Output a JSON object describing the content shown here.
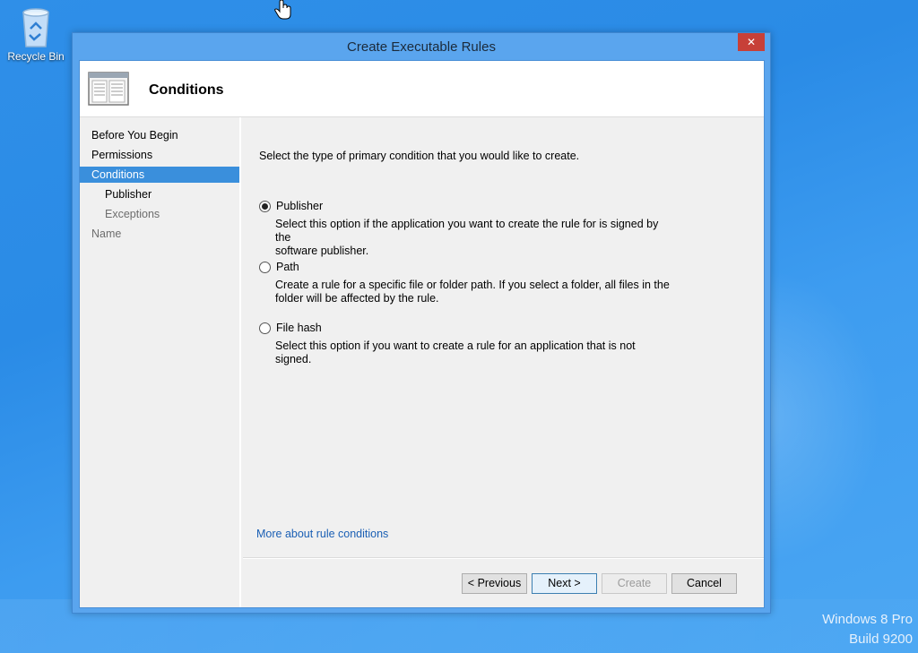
{
  "desktop": {
    "recycle_bin_label": "Recycle Bin",
    "watermark_line1": "Windows 8 Pro",
    "watermark_line2": "Build 9200"
  },
  "dialog": {
    "title": "Create Executable Rules",
    "close_glyph": "✕",
    "header_title": "Conditions",
    "nav": [
      {
        "label": "Before You Begin",
        "state": "normal"
      },
      {
        "label": "Permissions",
        "state": "normal"
      },
      {
        "label": "Conditions",
        "state": "selected"
      },
      {
        "label": "Publisher",
        "state": "normal"
      },
      {
        "label": "Exceptions",
        "state": "disabled"
      },
      {
        "label": "Name",
        "state": "disabled"
      }
    ],
    "prompt": "Select the type of primary condition that you would like to create.",
    "options": [
      {
        "label": "Publisher",
        "checked": true,
        "desc_line1": "Select this option if the application you want to create the rule for is signed by the",
        "desc_line2": "software publisher."
      },
      {
        "label": "Path",
        "checked": false,
        "desc_line1": "Create a rule for a specific file or folder path. If you select a folder, all files in the",
        "desc_line2": "folder will be affected by the rule."
      },
      {
        "label": "File hash",
        "checked": false,
        "desc_line1": "Select this option if you want to create a rule for an application that is not signed.",
        "desc_line2": ""
      }
    ],
    "link": "More about rule conditions",
    "buttons": {
      "previous": "< Previous",
      "next": "Next >",
      "create": "Create",
      "cancel": "Cancel"
    }
  },
  "colors": {
    "desktop": "#2f8fe8",
    "selected_nav": "#3a8fdc",
    "close_button": "#c74038",
    "link": "#1a5fb4"
  }
}
